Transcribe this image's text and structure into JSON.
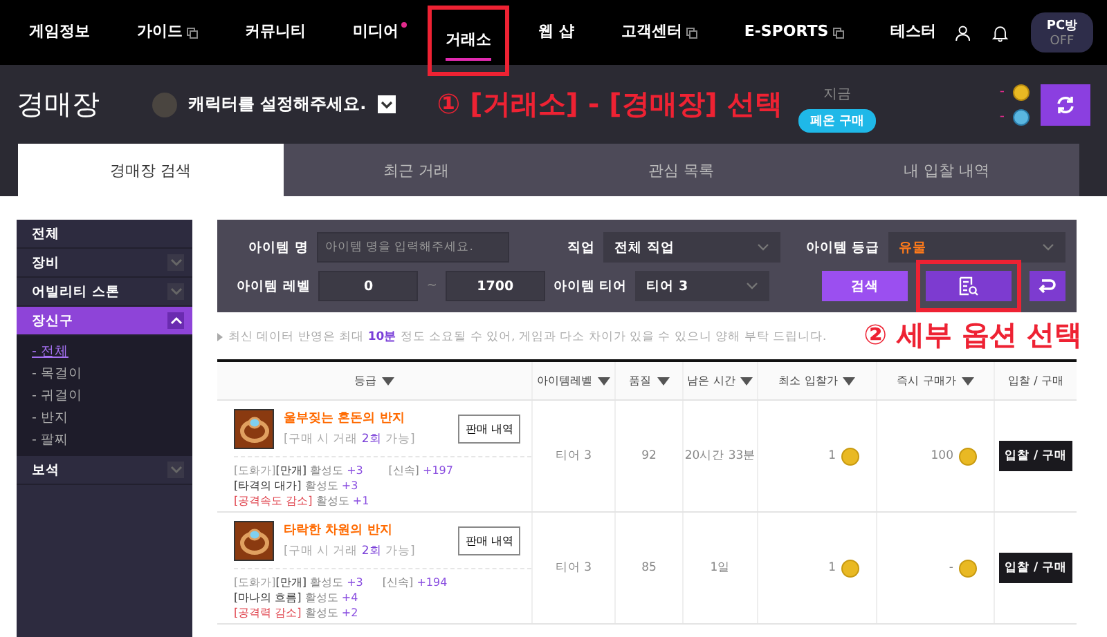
{
  "nav": {
    "items": [
      {
        "label": "게임정보",
        "selected": false,
        "external": false,
        "new_dot": false,
        "annotated": false
      },
      {
        "label": "가이드",
        "selected": false,
        "external": true,
        "new_dot": false,
        "annotated": false
      },
      {
        "label": "커뮤니티",
        "selected": false,
        "external": false,
        "new_dot": false,
        "annotated": false
      },
      {
        "label": "미디어",
        "selected": false,
        "external": false,
        "new_dot": true,
        "annotated": false
      },
      {
        "label": "거래소",
        "selected": true,
        "external": false,
        "new_dot": false,
        "annotated": true
      },
      {
        "label": "웹 샵",
        "selected": false,
        "external": false,
        "new_dot": false,
        "annotated": false
      },
      {
        "label": "고객센터",
        "selected": false,
        "external": true,
        "new_dot": false,
        "annotated": false
      },
      {
        "label": "E-SPORTS",
        "selected": false,
        "external": true,
        "new_dot": false,
        "annotated": false
      },
      {
        "label": "테스터",
        "selected": false,
        "external": false,
        "new_dot": false,
        "annotated": false
      }
    ],
    "pc_room": {
      "label": "PC방",
      "state": "OFF",
      "on": false
    }
  },
  "header": {
    "title": "경매장",
    "character": "캐릭터를 설정해주세요.",
    "annotation": "① [거래소] - [경매장] 선택",
    "now_label": "지금",
    "buy_button": "페온 구매",
    "currencies": [
      {
        "kind": "gold",
        "amount": "-"
      },
      {
        "kind": "crystal",
        "amount": "-"
      }
    ]
  },
  "tabs": [
    {
      "label": "경매장 검색",
      "selected": true
    },
    {
      "label": "최근 거래",
      "selected": false
    },
    {
      "label": "관심 목록",
      "selected": false
    },
    {
      "label": "내 입찰 내역",
      "selected": false
    }
  ],
  "sidebar": {
    "items": [
      {
        "label": "전체",
        "selected": false,
        "expandable": false
      },
      {
        "label": "장비",
        "selected": false,
        "expandable": true,
        "expanded": false
      },
      {
        "label": "어빌리티 스톤",
        "selected": false,
        "expandable": true,
        "expanded": false
      },
      {
        "label": "장신구",
        "selected": true,
        "expandable": true,
        "expanded": true,
        "children": [
          {
            "label": "- 전체",
            "selected": true
          },
          {
            "label": "- 목걸이",
            "selected": false
          },
          {
            "label": "- 귀걸이",
            "selected": false
          },
          {
            "label": "- 반지",
            "selected": false
          },
          {
            "label": "- 팔찌",
            "selected": false
          }
        ]
      },
      {
        "label": "보석",
        "selected": false,
        "expandable": true,
        "expanded": false
      }
    ]
  },
  "search": {
    "name_label": "아이템 명",
    "name_placeholder": "아이템 명을 입력해주세요.",
    "class_label": "직업",
    "class_value": "전체 직업",
    "grade_label": "아이템 등급",
    "grade_value": "유물",
    "level_label": "아이템 레벨",
    "level_min": "0",
    "level_sep": "~",
    "level_max": "1700",
    "tier_label": "아이템 티어",
    "tier_value": "티어 3",
    "search_button": "검색",
    "detail_annotated": true
  },
  "annotation_2": "② 세부 옵션 선택",
  "notice": {
    "text": "최신 데이터 반영은 최대 **10분** 정도 소요될 수 있어, 게임과 다소 차이가 있을 수 있으니 양해 부탁 드립니다."
  },
  "table": {
    "columns": [
      {
        "label": "등급",
        "sortable": true
      },
      {
        "label": "아이템레벨",
        "sortable": true
      },
      {
        "label": "품질",
        "sortable": true
      },
      {
        "label": "남은 시간",
        "sortable": true
      },
      {
        "label": "최소 입찰가",
        "sortable": true
      },
      {
        "label": "즉시 구매가",
        "sortable": true
      },
      {
        "label": "입찰 / 구매",
        "sortable": false
      }
    ],
    "rows": [
      {
        "name": "울부짖는 혼돈의 반지",
        "trade": "[구매 시 거래 **2회** 가능]",
        "history_button": "판매 내역",
        "tier": "티어 3",
        "quality": "92",
        "time": "20시간 33분",
        "min_bid": "1",
        "buy_now": "100",
        "action": "입찰 / 구매",
        "stat": {
          "name": "[신속]",
          "value": "+197"
        },
        "engravings": [
          {
            "penalty": false,
            "prefix": "[도화가]",
            "name": "[만개]",
            "label": "활성도",
            "value": "+3"
          },
          {
            "penalty": false,
            "name": "[타격의 대가]",
            "label": "활성도",
            "value": "+3"
          },
          {
            "penalty": true,
            "name": "[공격속도 감소]",
            "label": "활성도",
            "value": "+1"
          }
        ]
      },
      {
        "name": "타락한 차원의 반지",
        "trade": "[구매 시 거래 **2회** 가능]",
        "history_button": "판매 내역",
        "tier": "티어 3",
        "quality": "85",
        "time": "1일",
        "min_bid": "1",
        "buy_now": "-",
        "action": "입찰 / 구매",
        "stat": {
          "name": "[신속]",
          "value": "+194"
        },
        "engravings": [
          {
            "penalty": false,
            "prefix": "[도화가]",
            "name": "[만개]",
            "label": "활성도",
            "value": "+3"
          },
          {
            "penalty": false,
            "name": "[마나의 흐름]",
            "label": "활성도",
            "value": "+4"
          },
          {
            "penalty": true,
            "name": "[공격력 감소]",
            "label": "활성도",
            "value": "+2"
          }
        ]
      }
    ]
  }
}
